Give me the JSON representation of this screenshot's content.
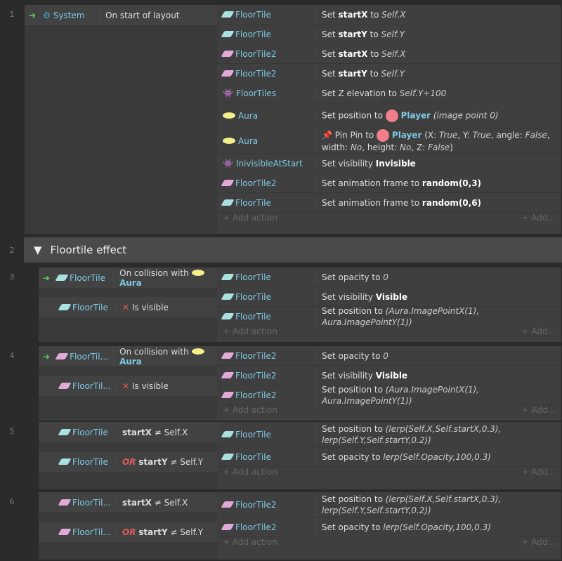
{
  "add_action": "+ Add action",
  "add_short": "+ Add...",
  "group": {
    "index": "2",
    "title": "Floortile effect"
  },
  "events": [
    {
      "n": "1",
      "cond": [
        {
          "icon": "gear",
          "obj": "System",
          "text": "On start of layout",
          "trigger": true
        }
      ],
      "acts": [
        [
          "tile",
          "FloorTile",
          "Set <b>startX</b> to <i>Self.X</i>"
        ],
        [
          "tile",
          "FloorTile",
          "Set <b>startY</b> to <i>Self.Y</i>"
        ],
        [
          "tile2",
          "FloorTile2",
          "Set <b>startX</b> to <i>Self.X</i>"
        ],
        [
          "tile2",
          "FloorTile2",
          "Set <b>startY</b> to <i>Self.Y</i>"
        ],
        [
          "family",
          "FloorTiles",
          "Set Z elevation to <i>Self.Y÷100</i>"
        ],
        [
          "ell",
          "Aura",
          "Set position to <span class='pl'></span> <b style='color:#7ec8e3'>Player</b> <i>(image point 0)</i>"
        ],
        [
          "ell",
          "Aura",
          "📌 Pin Pin to <span class='pl'></span> <b style='color:#7ec8e3'>Player</b> (X: <i>True</i>, Y: <i>True</i>, angle: <i>False</i>, width: <i>No</i>, height: <i>No</i>, Z: <i>False</i>)"
        ],
        [
          "family",
          "InivisibleAtStart",
          "Set visibility <b>Invisible</b>"
        ],
        [
          "tile2",
          "FloorTile2",
          "Set animation frame to <b>random(0,3)</b>"
        ],
        [
          "tile",
          "FloorTile",
          "Set animation frame to <b>random(0,6)</b>"
        ]
      ]
    },
    {
      "n": "3",
      "cond": [
        {
          "icon": "tile",
          "obj": "FloorTile",
          "text": "On collision with <span class='ell'></span> <b style='color:#7ec8e3'>Aura</b>",
          "trigger": true
        },
        {
          "icon": "tile",
          "obj": "FloorTile",
          "text": "<span class='x'>✕</span> Is visible"
        }
      ],
      "acts": [
        [
          "tile",
          "FloorTile",
          "Set opacity to <i>0</i>"
        ],
        [
          "tile",
          "FloorTile",
          "Set visibility <b>Visible</b>"
        ],
        [
          "tile",
          "FloorTile",
          "Set position to <i>(Aura.ImagePointX(1), Aura.ImagePointY(1))</i>"
        ]
      ]
    },
    {
      "n": "4",
      "cond": [
        {
          "icon": "tile2",
          "obj": "FloorTil...",
          "text": "On collision with <span class='ell'></span> <b style='color:#7ec8e3'>Aura</b>",
          "trigger": true
        },
        {
          "icon": "tile2",
          "obj": "FloorTil...",
          "text": "<span class='x'>✕</span> Is visible"
        }
      ],
      "acts": [
        [
          "tile2",
          "FloorTile2",
          "Set opacity to <i>0</i>"
        ],
        [
          "tile2",
          "FloorTile2",
          "Set visibility <b>Visible</b>"
        ],
        [
          "tile2",
          "FloorTile2",
          "Set position to <i>(Aura.ImagePointX(1), Aura.ImagePointY(1))</i>"
        ]
      ]
    },
    {
      "n": "5",
      "cond": [
        {
          "icon": "tile",
          "obj": "FloorTile",
          "text": "<b>startX</b> ≠ Self.X"
        },
        {
          "icon": "tile",
          "obj": "FloorTile",
          "text": "<span class='red'>OR</span> <b>startY</b> ≠ Self.Y"
        }
      ],
      "acts": [
        [
          "tile",
          "FloorTile",
          "Set position to <i>(lerp(Self.X,Self.startX,0.3), lerp(Self.Y,Self.startY,0.2))</i>"
        ],
        [
          "tile",
          "FloorTile",
          "Set opacity to <i>lerp(Self.Opacity,100,0.3)</i>"
        ]
      ]
    },
    {
      "n": "6",
      "cond": [
        {
          "icon": "tile2",
          "obj": "FloorTil...",
          "text": "<b>startX</b> ≠ Self.X"
        },
        {
          "icon": "tile2",
          "obj": "FloorTil...",
          "text": "<span class='red'>OR</span> <b>startY</b> ≠ Self.Y"
        }
      ],
      "acts": [
        [
          "tile2",
          "FloorTile2",
          "Set position to <i>(lerp(Self.X,Self.startX,0.3), lerp(Self.Y,Self.startY,0.2))</i>"
        ],
        [
          "tile2",
          "FloorTile2",
          "Set opacity to <i>lerp(Self.Opacity,100,0.3)</i>"
        ]
      ]
    }
  ]
}
